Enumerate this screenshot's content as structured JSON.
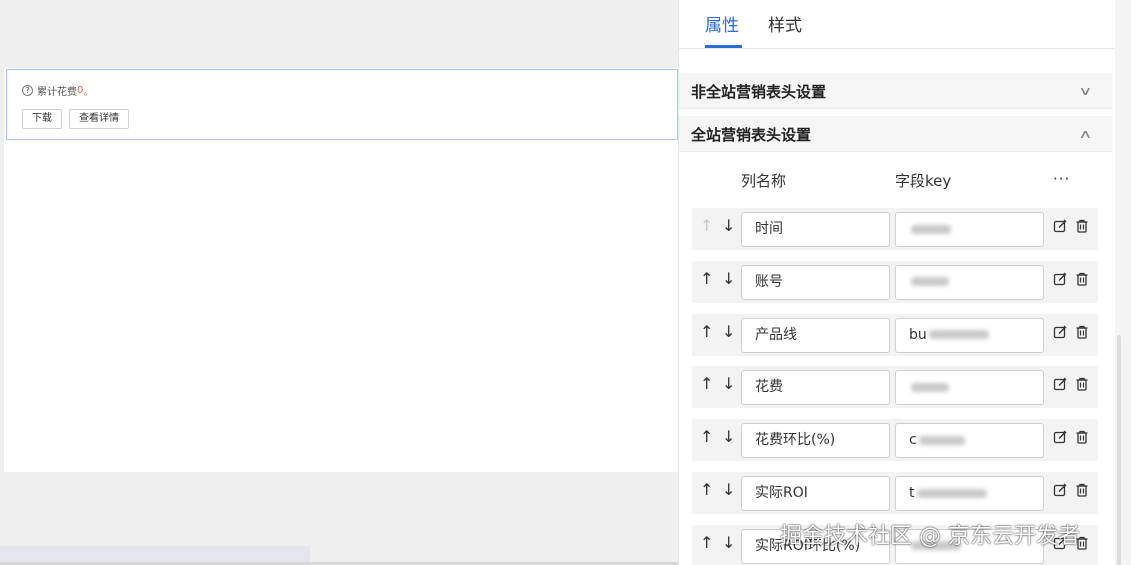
{
  "canvas": {
    "widget": {
      "summary_prefix": "累计花费",
      "summary_value": "0",
      "summary_suffix": "。",
      "download_label": "下载",
      "details_label": "查看详情"
    }
  },
  "panel": {
    "tabs": [
      {
        "label": "属性",
        "active": true
      },
      {
        "label": "样式",
        "active": false
      }
    ],
    "sections": [
      {
        "title": "非全站营销表头设置",
        "expanded": false
      },
      {
        "title": "全站营销表头设置",
        "expanded": true
      }
    ],
    "columns_header": {
      "name": "列名称",
      "key": "字段key",
      "more": "···"
    },
    "rows": [
      {
        "name": "时间",
        "key_visible": "",
        "up_disabled": true
      },
      {
        "name": "账号",
        "key_visible": "",
        "up_disabled": false
      },
      {
        "name": "产品线",
        "key_visible": "bu",
        "up_disabled": false
      },
      {
        "name": "花费",
        "key_visible": "",
        "up_disabled": false
      },
      {
        "name": "花费环比(%)",
        "key_visible": "c",
        "up_disabled": false
      },
      {
        "name": "实际ROI",
        "key_visible": "t",
        "up_disabled": false
      },
      {
        "name": "实际ROI环比(%)",
        "key_visible": "",
        "up_disabled": false
      }
    ]
  },
  "watermark": "掘金技术社区 @ 京东云开发者",
  "colors": {
    "accent": "#2b6bd4",
    "highlight": "#e8604c"
  }
}
